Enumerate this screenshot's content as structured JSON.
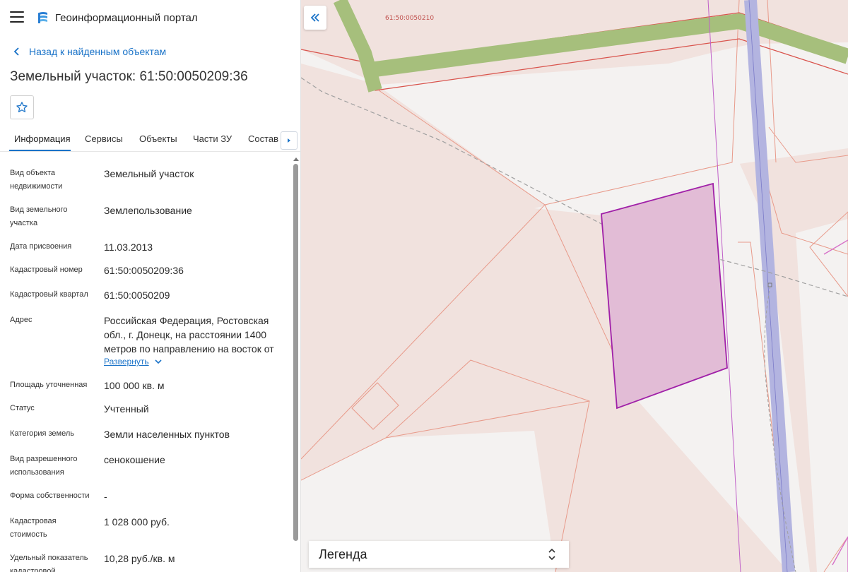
{
  "header": {
    "app_title": "Геоинформационный портал",
    "menu_icon": "hamburger-icon",
    "logo_icon": "portal-logo-icon"
  },
  "navigation": {
    "back_label": "Назад к найденным объектам"
  },
  "object": {
    "title": "Земельный участок: 61:50:0050209:36"
  },
  "tabs": [
    {
      "label": "Информация",
      "active": true
    },
    {
      "label": "Сервисы",
      "active": false
    },
    {
      "label": "Объекты",
      "active": false
    },
    {
      "label": "Части ЗУ",
      "active": false
    },
    {
      "label": "Состав",
      "active": false
    }
  ],
  "attributes": [
    {
      "label": "Вид объекта недвижимости",
      "value": "Земельный участок"
    },
    {
      "label": "Вид земельного участка",
      "value": "Землепользование"
    },
    {
      "label": "Дата присвоения",
      "value": "11.03.2013"
    },
    {
      "label": "Кадастровый номер",
      "value": "61:50:0050209:36"
    },
    {
      "label": "Кадастровый квартал",
      "value": "61:50:0050209"
    },
    {
      "label": "Адрес",
      "value": "Российская Федерация, Ростовская обл., г. Донецк, на расстоянии 1400 метров по направлению на восток от",
      "expand_label": "Развернуть"
    },
    {
      "label": "Площадь уточненная",
      "value": "100 000 кв. м"
    },
    {
      "label": "Статус",
      "value": "Учтенный"
    },
    {
      "label": "Категория земель",
      "value": "Земли населенных пунктов"
    },
    {
      "label": "Вид разрешенного использования",
      "value": "сенокошение"
    },
    {
      "label": "Форма собственности",
      "value": "-"
    },
    {
      "label": "Кадастровая стоимость",
      "value": "1 028 000 руб."
    },
    {
      "label": "Удельный показатель кадастровой",
      "value": "10,28 руб./кв. м"
    }
  ],
  "map": {
    "quarter_label": "61:50:0050210",
    "legend_label": "Легенда",
    "colors": {
      "land_fill": "#f1e2de",
      "parcel_line": "#e89a8a",
      "selected_fill": "#e2bcd6",
      "selected_stroke": "#a020a8",
      "road_green": "#a6bf7c",
      "road_blue": "#b3b4e0"
    }
  }
}
